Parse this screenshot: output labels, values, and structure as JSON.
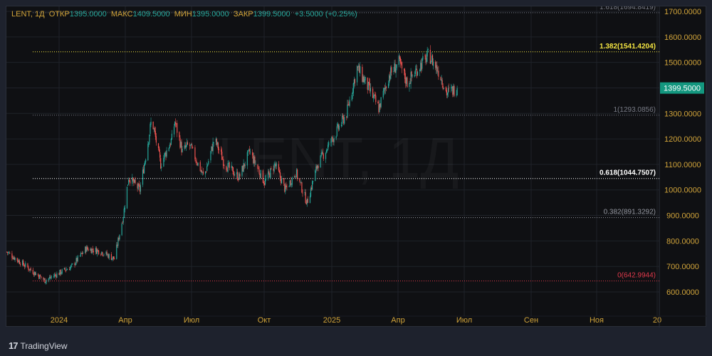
{
  "legend": {
    "symbol": "LENT, 1Д",
    "open_label": "ОТКР",
    "open": "1395.0000",
    "high_label": "МАКС",
    "high": "1409.5000",
    "low_label": "МИН",
    "low": "1395.0000",
    "close_label": "ЗАКР",
    "close": "1399.5000",
    "change": "+3.5000 (+0.25%)"
  },
  "watermark": "LENT, 1Д",
  "branding": "TradingView",
  "colors": {
    "up": "#26a69a",
    "down": "#ef5350",
    "axis_text": "#d1a43a",
    "background": "#0f1013",
    "price_badge": "#13977f"
  },
  "chart_data": {
    "type": "candlestick",
    "symbol": "LENT",
    "interval": "1Д",
    "ylim": [
      570,
      1720
    ],
    "y_ticks": [
      "600.0000",
      "700.0000",
      "800.0000",
      "900.0000",
      "1000.0000",
      "1100.0000",
      "1200.0000",
      "1300.0000",
      "1400.0000",
      "1500.0000",
      "1600.0000",
      "1700.0000"
    ],
    "x_ticks": [
      "2024",
      "Апр",
      "Июл",
      "Окт",
      "2025",
      "Апр",
      "Июл",
      "Сен",
      "Ноя",
      "20"
    ],
    "grid": true,
    "last_price": "1399.5000",
    "approx_closes": [
      [
        "2023-10-23",
        757
      ],
      [
        "2023-12-13",
        645
      ],
      [
        "2024-01-18",
        700
      ],
      [
        "2024-02-06",
        770
      ],
      [
        "2024-02-25",
        760
      ],
      [
        "2024-03-15",
        730
      ],
      [
        "2024-03-27",
        900
      ],
      [
        "2024-04-03",
        1050
      ],
      [
        "2024-04-18",
        1000
      ],
      [
        "2024-04-27",
        1150
      ],
      [
        "2024-05-04",
        1280
      ],
      [
        "2024-05-16",
        1100
      ],
      [
        "2024-05-31",
        1200
      ],
      [
        "2024-06-04",
        1270
      ],
      [
        "2024-06-14",
        1150
      ],
      [
        "2024-06-23",
        1180
      ],
      [
        "2024-07-13",
        1050
      ],
      [
        "2024-07-27",
        1200
      ],
      [
        "2024-08-10",
        1100
      ],
      [
        "2024-08-29",
        1050
      ],
      [
        "2024-09-12",
        1150
      ],
      [
        "2024-10-02",
        1030
      ],
      [
        "2024-10-16",
        1100
      ],
      [
        "2024-10-30",
        1000
      ],
      [
        "2024-11-13",
        1070
      ],
      [
        "2024-11-28",
        950
      ],
      [
        "2024-12-12",
        1100
      ],
      [
        "2025-01-01",
        1200
      ],
      [
        "2025-01-20",
        1300
      ],
      [
        "2025-02-03",
        1480
      ],
      [
        "2025-02-18",
        1400
      ],
      [
        "2025-03-04",
        1320
      ],
      [
        "2025-03-18",
        1450
      ],
      [
        "2025-03-31",
        1500
      ],
      [
        "2025-04-11",
        1420
      ],
      [
        "2025-04-26",
        1480
      ],
      [
        "2025-05-10",
        1530
      ],
      [
        "2025-05-24",
        1460
      ],
      [
        "2025-06-03",
        1380
      ],
      [
        "2025-06-17",
        1399.5
      ]
    ],
    "fib_levels": [
      {
        "level": 0,
        "price": 642.9944,
        "label": "0(642.9944)",
        "color": "#e0394b"
      },
      {
        "level": 0.382,
        "price": 891.3292,
        "label": "0.382(891.3292)",
        "color": "#9598a1"
      },
      {
        "level": 0.618,
        "price": 1044.7507,
        "label": "0.618(1044.7507)",
        "color": "#ffffff"
      },
      {
        "level": 1,
        "price": 1293.0856,
        "label": "1(1293.0856)",
        "color": "#787b86"
      },
      {
        "level": 1.382,
        "price": 1541.4204,
        "label": "1.382(1541.4204)",
        "color": "#f5e642"
      },
      {
        "level": 1.618,
        "price": 1694.8419,
        "label": "1.618(1694.8419)",
        "color": "#787b86"
      }
    ]
  }
}
